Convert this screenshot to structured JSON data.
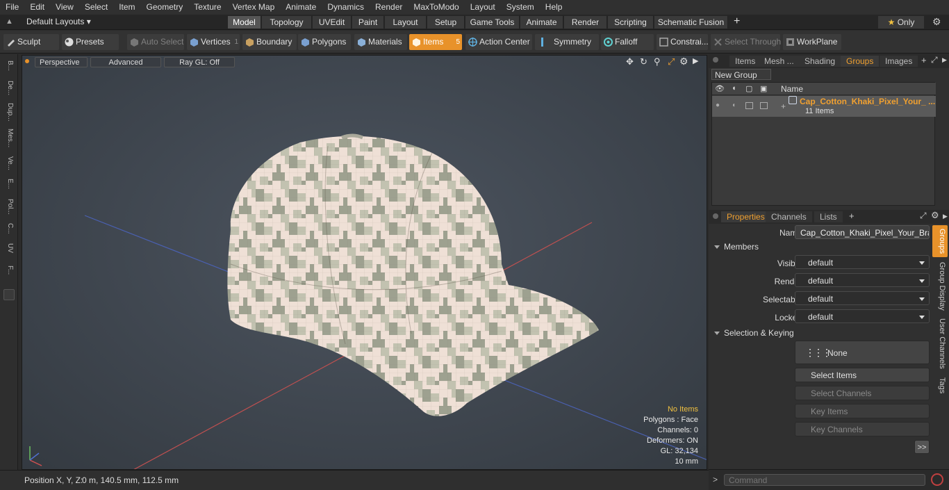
{
  "menu": [
    "File",
    "Edit",
    "View",
    "Select",
    "Item",
    "Geometry",
    "Texture",
    "Vertex Map",
    "Animate",
    "Dynamics",
    "Render",
    "MaxToModo",
    "Layout",
    "System",
    "Help"
  ],
  "layout_selector": "Default Layouts",
  "layout_tabs": [
    "Model",
    "Topology",
    "UVEdit",
    "Paint",
    "Layout",
    "Setup",
    "Game Tools",
    "Animate",
    "Render",
    "Scripting",
    "Schematic Fusion"
  ],
  "layout_active": "Model",
  "only_label": "Only",
  "toolbar": {
    "sculpt": "Sculpt",
    "presets": "Presets",
    "auto_select": "Auto Select",
    "vertices": "Vertices",
    "vertices_count": "1",
    "boundary": "Boundary",
    "polygons": "Polygons",
    "materials": "Materials",
    "items": "Items",
    "items_count": "5",
    "action_center": "Action Center",
    "symmetry": "Symmetry",
    "falloff": "Falloff",
    "constraints": "Constrai...",
    "select_through": "Select Through",
    "workplane": "WorkPlane"
  },
  "left_tabs": [
    "B...",
    "De...",
    "Dup...",
    "Mes...",
    "Ve...",
    "E...",
    "Pol...",
    "C...",
    "UV",
    "F..."
  ],
  "viewport": {
    "perspective": "Perspective",
    "advanced": "Advanced",
    "raygl": "Ray GL: Off",
    "hud": {
      "no_items": "No Items",
      "polygons": "Polygons : Face",
      "channels": "Channels: 0",
      "deformers": "Deformers: ON",
      "gl": "GL: 32,134",
      "scale": "10 mm"
    }
  },
  "status": {
    "position_label": "Position X, Y, Z:",
    "position_value": "0 m, 140.5 mm, 112.5 mm"
  },
  "right_panel": {
    "top_tabs": [
      "Items",
      "Mesh ...",
      "Shading",
      "Groups",
      "Images"
    ],
    "top_active": "Groups",
    "new_group": "New Group",
    "name_header": "Name",
    "group_name": "Cap_Cotton_Khaki_Pixel_Your_ ...",
    "group_count": "11 Items",
    "prop_tabs": [
      "Properties",
      "Channels",
      "Lists"
    ],
    "prop_active": "Properties",
    "name_label": "Name",
    "name_value": "Cap_Cotton_Khaki_Pixel_Your_Brand",
    "members_section": "Members",
    "visible_label": "Visible",
    "visible_value": "default",
    "render_label": "Render",
    "render_value": "default",
    "selectable_label": "Selectable",
    "selectable_value": "default",
    "locked_label": "Locked",
    "locked_value": "default",
    "selection_section": "Selection & Keying",
    "none_label": "None",
    "select_items": "Select Items",
    "select_channels": "Select Channels",
    "key_items": "Key Items",
    "key_channels": "Key Channels",
    "more": ">>",
    "side_tabs": [
      "Groups",
      "Group Display",
      "User Channels",
      "Tags"
    ],
    "command_placeholder": "Command"
  },
  "colors": {
    "accent": "#e8922a",
    "active_tab": "#f0a030",
    "group_name": "#f0a030"
  }
}
